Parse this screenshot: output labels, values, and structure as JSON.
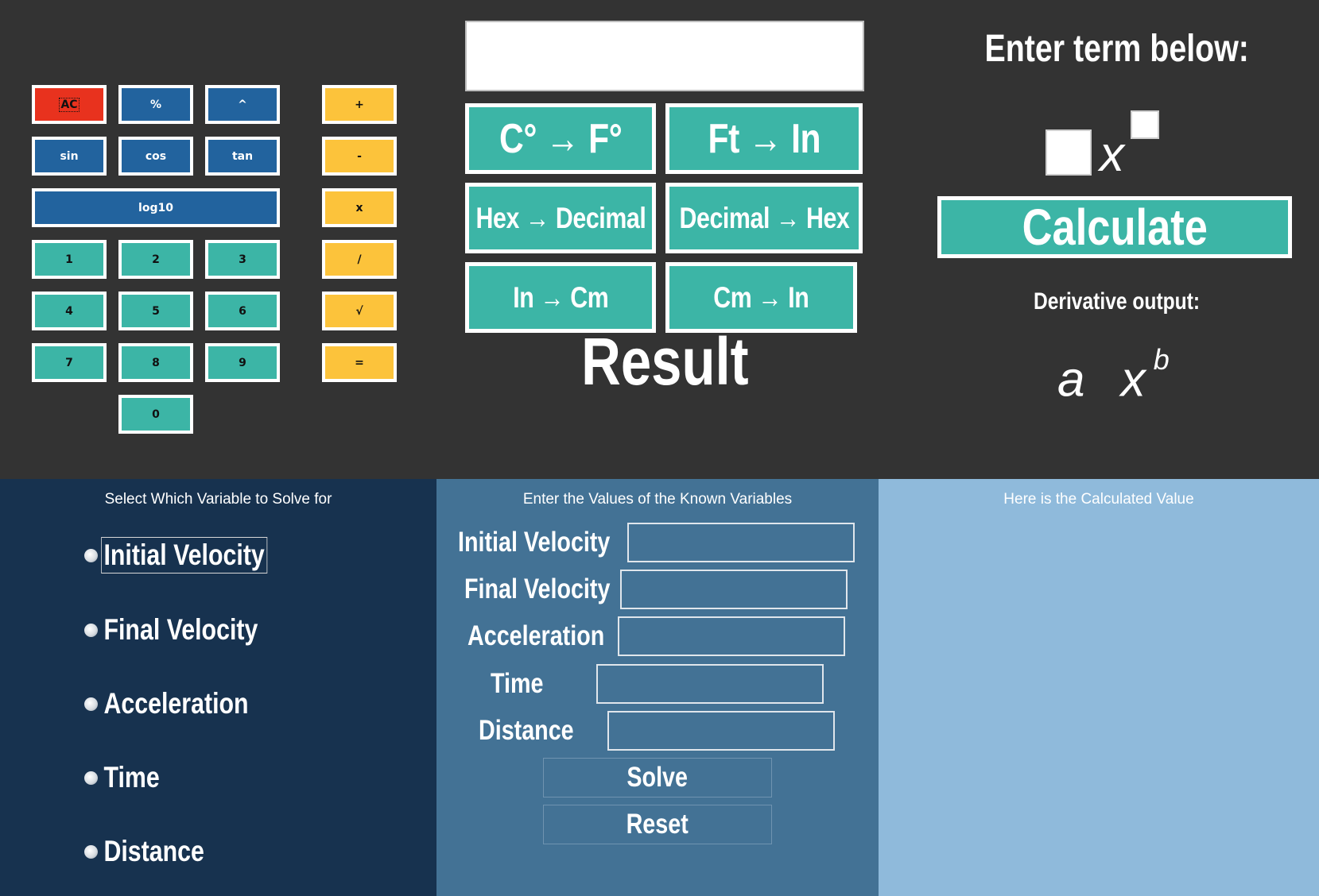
{
  "calculator": {
    "keys": {
      "ac": "AC",
      "percent": "%",
      "power": "^",
      "plus": "+",
      "sin": "sin",
      "cos": "cos",
      "tan": "tan",
      "minus": "-",
      "log10": "log10",
      "multiply": "x",
      "one": "1",
      "two": "2",
      "three": "3",
      "divide": "/",
      "four": "4",
      "five": "5",
      "six": "6",
      "sqrt": "√",
      "seven": "7",
      "eight": "8",
      "nine": "9",
      "equals": "=",
      "zero": "0"
    },
    "colors": {
      "red": "#e8321e",
      "blue": "#22639e",
      "teal": "#3cb5a6",
      "yellow": "#fcc33b"
    }
  },
  "converter": {
    "display_value": "",
    "buttons": {
      "c_to_f": "C° → F°",
      "ft_to_in": "Ft → In",
      "hex_to_decimal": "Hex → Decimal",
      "decimal_to_hex": "Decimal → Hex",
      "in_to_cm": "In → Cm",
      "cm_to_in": "Cm → In"
    },
    "result_label": "Result"
  },
  "derivative": {
    "title": "Enter term below:",
    "variable": "x",
    "coefficient_value": "",
    "exponent_value": "",
    "calculate_label": "Calculate",
    "output_label": "Derivative output:",
    "output_base": "a x",
    "output_exponent": "b"
  },
  "kinematics": {
    "solve_for": {
      "title": "Select Which Variable to Solve for",
      "options": [
        "Initial Velocity",
        "Final Velocity",
        "Acceleration",
        "Time",
        "Distance"
      ]
    },
    "known_values": {
      "title": "Enter the Values of the Known Variables",
      "fields": [
        "Initial Velocity",
        "Final Velocity",
        "Acceleration",
        "Time",
        "Distance"
      ],
      "solve_label": "Solve",
      "reset_label": "Reset"
    },
    "result": {
      "title": "Here is the Calculated Value",
      "value": ""
    },
    "colors": {
      "left": "#17324f",
      "middle": "#437295",
      "right": "#8fbadb"
    }
  }
}
